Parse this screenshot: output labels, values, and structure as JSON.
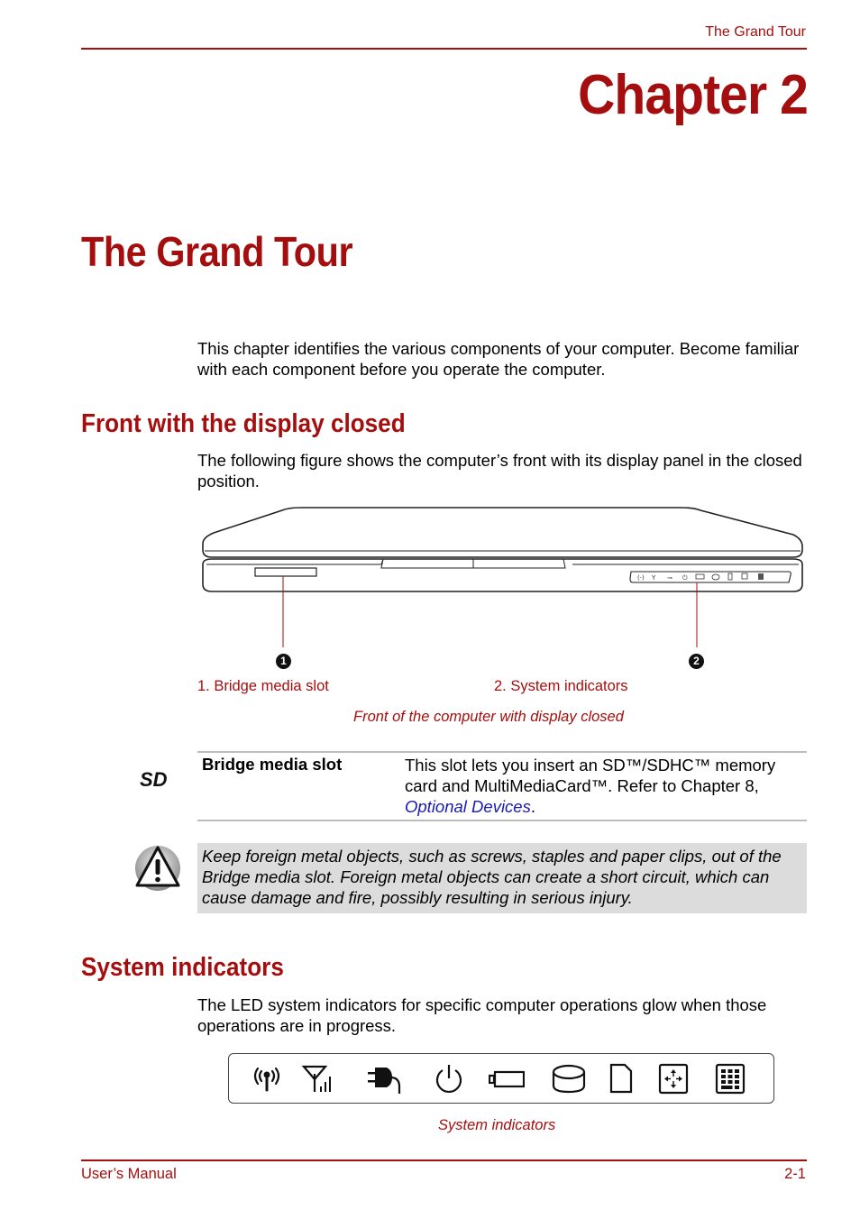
{
  "header": {
    "running_head": "The Grand Tour"
  },
  "chapter": {
    "label": "Chapter 2",
    "title": "The Grand Tour",
    "intro": "This chapter identifies the various components of your computer. Become familiar with each component before you operate the computer."
  },
  "front_section": {
    "heading": "Front with the display closed",
    "body": "The following figure shows the computer’s front with its display panel in the closed position.",
    "figure": {
      "callouts": [
        {
          "number": "1",
          "label": "1. Bridge media slot"
        },
        {
          "number": "2",
          "label": "2. System indicators"
        }
      ],
      "caption": "Front of the computer with display closed"
    }
  },
  "component_table": {
    "rows": [
      {
        "icon": "sd-card-logo-icon",
        "term": "Bridge media slot",
        "description_prefix": "This slot lets you insert an SD™/SDHC™ memory card and MultiMediaCard™. Refer to Chapter 8, ",
        "link_text": "Optional Devices",
        "description_suffix": "."
      }
    ]
  },
  "warning": {
    "icon": "warning-triangle-icon",
    "text": "Keep foreign metal objects, such as screws, staples and paper clips, out of the Bridge media slot. Foreign metal objects can create a short circuit, which can cause damage and fire, possibly resulting in serious injury."
  },
  "indicators_section": {
    "heading": "System indicators",
    "body": "The LED system indicators for specific computer operations glow when those operations are in progress.",
    "icons": [
      "wireless-communication-icon",
      "wireless-wan-icon",
      "dc-in-icon",
      "power-icon",
      "battery-icon",
      "hard-disk-icon",
      "media-slot-icon",
      "arrow-mode-icon",
      "numeric-mode-icon"
    ],
    "caption": "System indicators"
  },
  "footer": {
    "left": "User’s Manual",
    "right": "2-1"
  },
  "colors": {
    "accent": "#a50e0e",
    "link": "#1a1ab5",
    "warning_bg": "#dcdcdc"
  }
}
